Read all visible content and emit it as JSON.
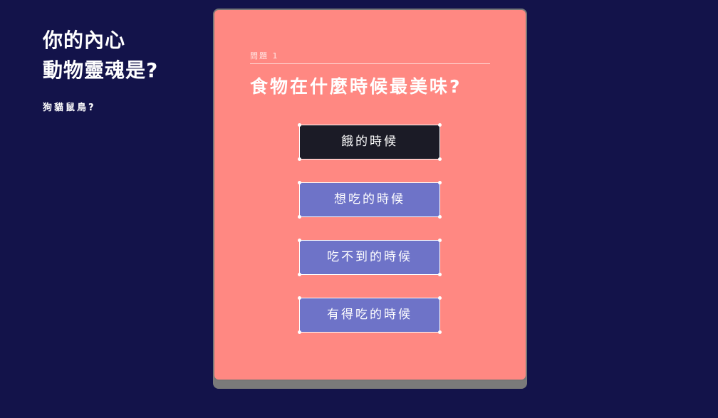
{
  "intro": {
    "title_line1": "你的內心",
    "title_line2": "動物靈魂是?",
    "subtitle": "狗貓鼠鳥?"
  },
  "quiz": {
    "question_label": "問題 1",
    "question": "食物在什麼時候最美味?",
    "answers": [
      {
        "label": "餓的時候",
        "selected": true
      },
      {
        "label": "想吃的時候",
        "selected": false
      },
      {
        "label": "吃不到的時候",
        "selected": false
      },
      {
        "label": "有得吃的時候",
        "selected": false
      }
    ]
  },
  "colors": {
    "background": "#13134a",
    "card": "#ff8882",
    "answer_default": "#6e73c8",
    "answer_selected": "#1b1b26"
  }
}
